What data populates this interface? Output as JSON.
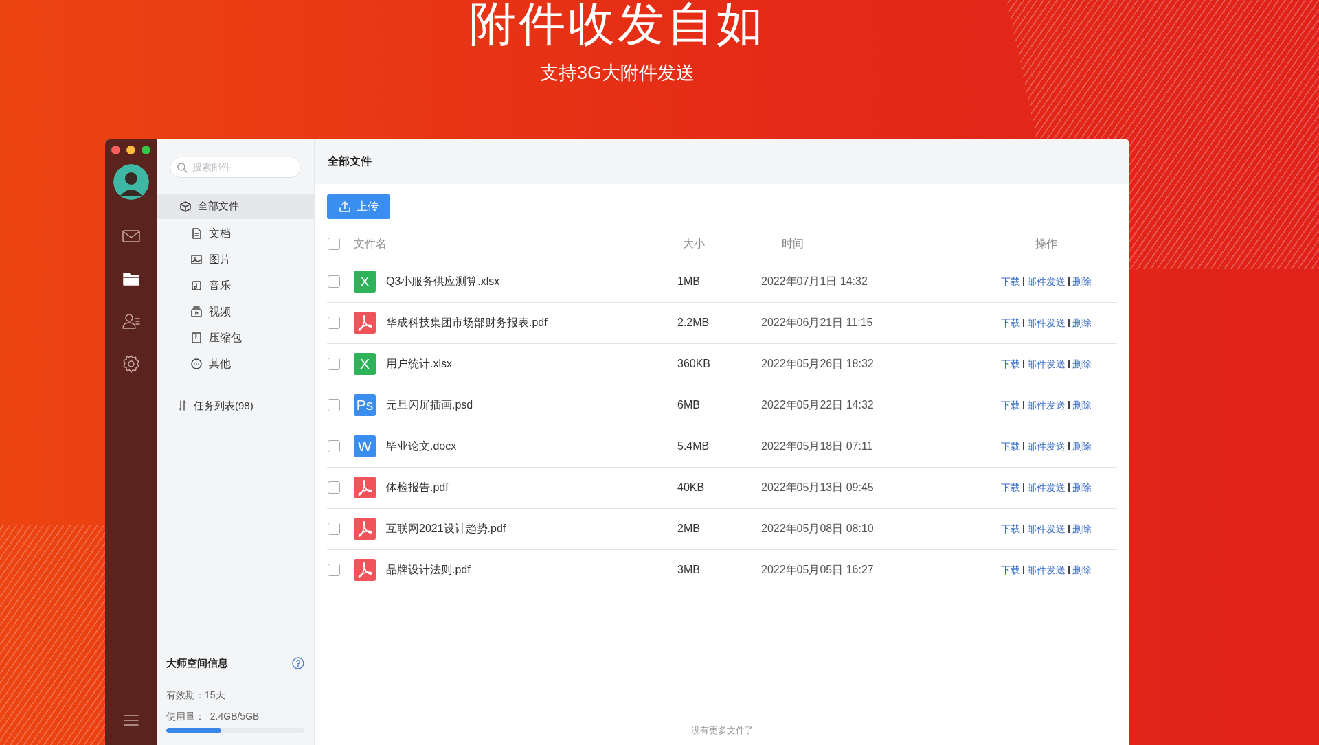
{
  "banner": {
    "title": "附件收发自如",
    "subtitle": "支持3G大附件发送"
  },
  "window": {
    "traffic_lights": [
      {
        "color": "#fc605c"
      },
      {
        "color": "#fdbc40"
      },
      {
        "color": "#34c84a"
      }
    ]
  },
  "rail": {
    "items": [
      {
        "kind": "mail",
        "selected": false
      },
      {
        "kind": "folder",
        "selected": true
      },
      {
        "kind": "contacts",
        "selected": false
      },
      {
        "kind": "settings",
        "selected": false
      }
    ]
  },
  "sidebar": {
    "search": {
      "placeholder": "搜索邮件"
    },
    "items": [
      {
        "label": "全部文件",
        "selected": true,
        "children": [
          {
            "label": "文档",
            "selected": false
          },
          {
            "label": "图片",
            "selected": false
          },
          {
            "label": "音乐",
            "selected": false
          },
          {
            "label": "视频",
            "selected": false
          },
          {
            "label": "压缩包",
            "selected": false
          },
          {
            "label": "其他",
            "selected": false
          }
        ]
      }
    ],
    "tasks": "任务列表(98)",
    "storage": {
      "title": "大师空间信息",
      "validity_label": "有效期：",
      "validity": "15天",
      "usage_label": "使用量：",
      "usage": "2.4GB/5GB",
      "level": 0.4
    }
  },
  "main": {
    "title": "全部文件",
    "upload_button": "上传",
    "table": {
      "select_all_checked": false,
      "columns": [
        "文件名",
        "大小",
        "时间",
        "操作"
      ],
      "rows": [
        {
          "kind": "xlsx",
          "icon_label": "X",
          "name": "Q3小服务供应测算.xlsx",
          "size": "1MB",
          "time": "2022年07月1日 14:32",
          "checked": false,
          "actions": [
            "下载",
            "邮件发送",
            "删除"
          ]
        },
        {
          "kind": "pdf",
          "name": "华成科技集团市场部财务报表.pdf",
          "size": "2.2MB",
          "time": "2022年06月21日 11:15",
          "checked": false,
          "actions": [
            "下载",
            "邮件发送",
            "删除"
          ]
        },
        {
          "kind": "xlsx",
          "icon_label": "X",
          "name": "用户统计.xlsx",
          "size": "360KB",
          "time": "2022年05月26日 18:32",
          "checked": false,
          "actions": [
            "下载",
            "邮件发送",
            "删除"
          ]
        },
        {
          "kind": "psd",
          "icon_label": "Ps",
          "name": "元旦闪屏插画.psd",
          "size": "6MB",
          "time": "2022年05月22日 14:32",
          "checked": false,
          "actions": [
            "下载",
            "邮件发送",
            "删除"
          ]
        },
        {
          "kind": "docx",
          "icon_label": "W",
          "name": "毕业论文.docx",
          "size": "5.4MB",
          "time": "2022年05月18日 07:11",
          "checked": false,
          "actions": [
            "下载",
            "邮件发送",
            "删除"
          ]
        },
        {
          "kind": "pdf",
          "name": "体检报告.pdf",
          "size": "40KB",
          "time": "2022年05月13日 09:45",
          "checked": false,
          "actions": [
            "下载",
            "邮件发送",
            "删除"
          ]
        },
        {
          "kind": "pdf",
          "name": "互联网2021设计趋势.pdf",
          "size": "2MB",
          "time": "2022年05月08日 08:10",
          "checked": false,
          "actions": [
            "下载",
            "邮件发送",
            "删除"
          ]
        },
        {
          "kind": "pdf",
          "name": "品牌设计法则.pdf",
          "size": "3MB",
          "time": "2022年05月05日 16:27",
          "checked": false,
          "actions": [
            "下载",
            "邮件发送",
            "删除"
          ]
        }
      ]
    },
    "footer": "没有更多文件了"
  }
}
